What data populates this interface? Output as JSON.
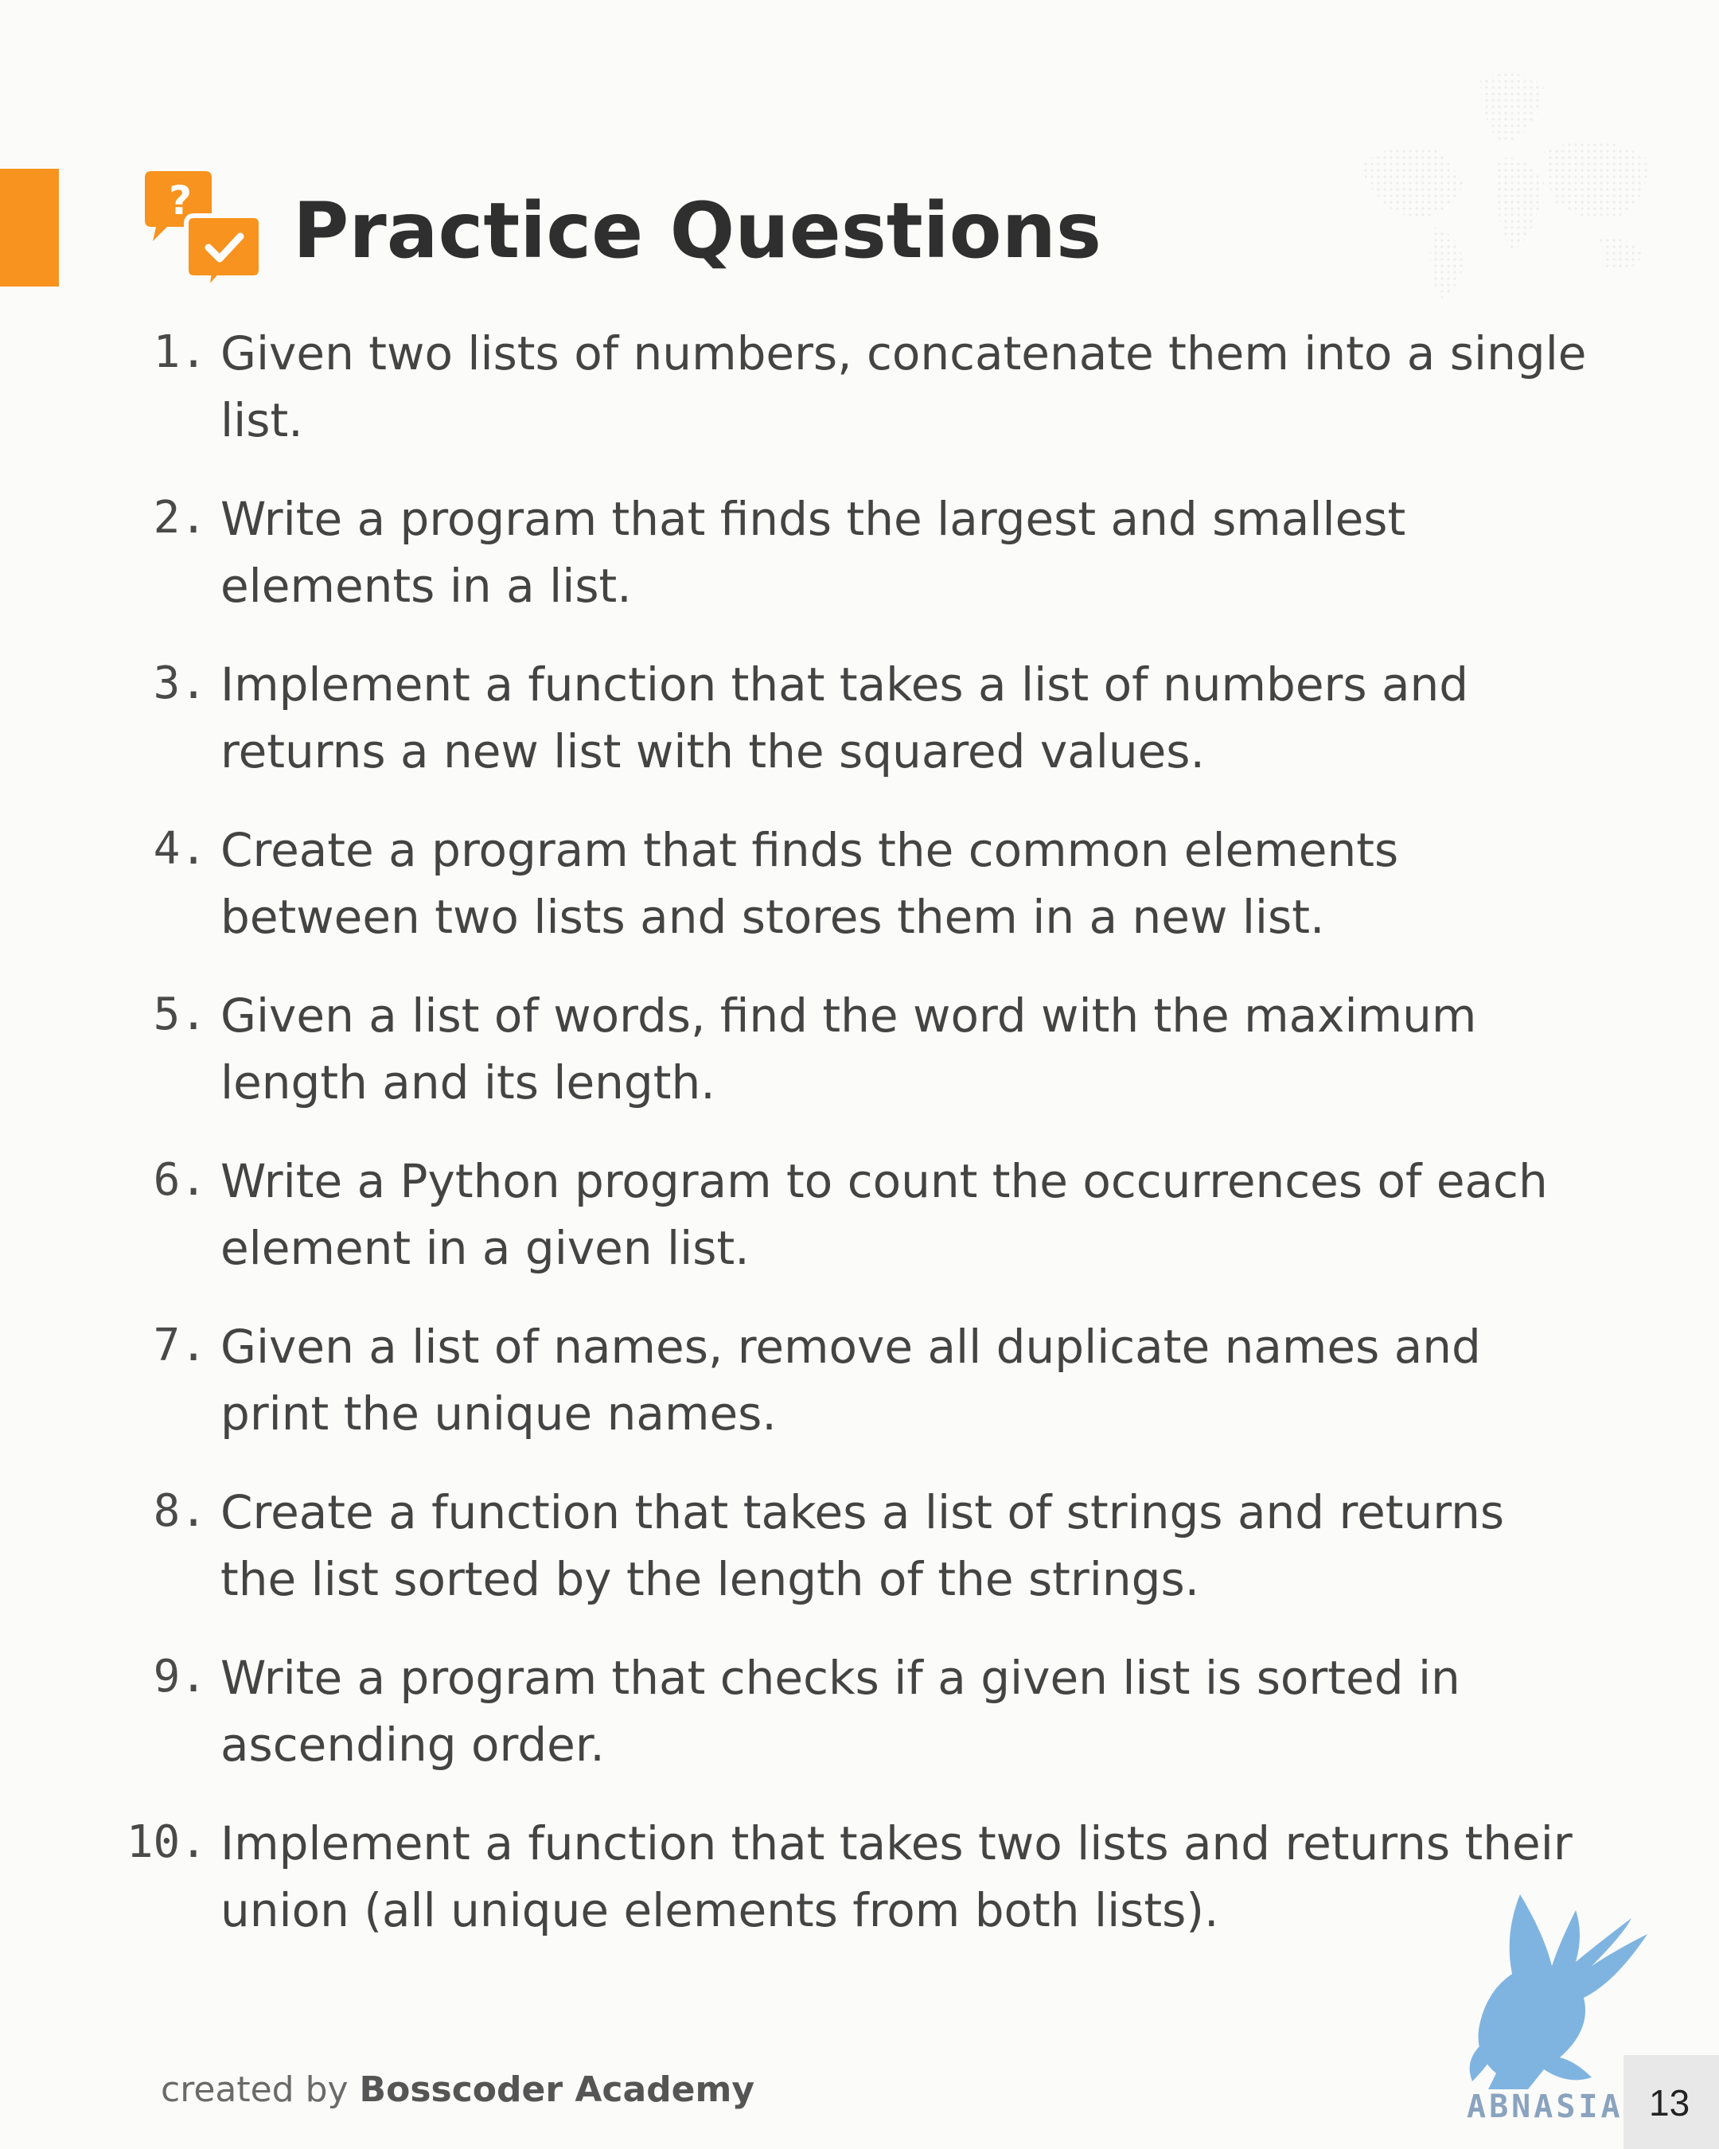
{
  "header": {
    "title": "Practice Questions",
    "icon": "question-answer-chat-icon",
    "accent_color": "#f7931e"
  },
  "questions": [
    {
      "number": "1.",
      "text": "Given two lists of numbers, concatenate them into a single list."
    },
    {
      "number": "2.",
      "text": "Write a program that finds the largest and smallest elements in a list."
    },
    {
      "number": "3.",
      "text": "Implement a function that takes a list of numbers and returns a new list with the squared values."
    },
    {
      "number": "4.",
      "text": "Create a program that finds the common elements between two lists and stores them in a new list."
    },
    {
      "number": "5.",
      "text": "Given a list of words, find the word with the maximum length and its length."
    },
    {
      "number": "6.",
      "text": "Write a Python program to count the occurrences of each element in a given list."
    },
    {
      "number": "7.",
      "text": "Given a list of names, remove all duplicate names and print the unique names."
    },
    {
      "number": "8.",
      "text": "Create a function that takes a list of strings and returns the list sorted by the length of the strings."
    },
    {
      "number": "9.",
      "text": "Write a program that checks if a given list is sorted in ascending order."
    },
    {
      "number": "10.",
      "text": "Implement a function that takes two lists and returns their union (all unique elements from both lists)."
    }
  ],
  "footer": {
    "prefix": "created by ",
    "brand": "Bosscoder Academy",
    "page_number": "13"
  },
  "watermark": {
    "text": "ABNASIA.ORG",
    "icon": "griffin-logo-icon"
  }
}
